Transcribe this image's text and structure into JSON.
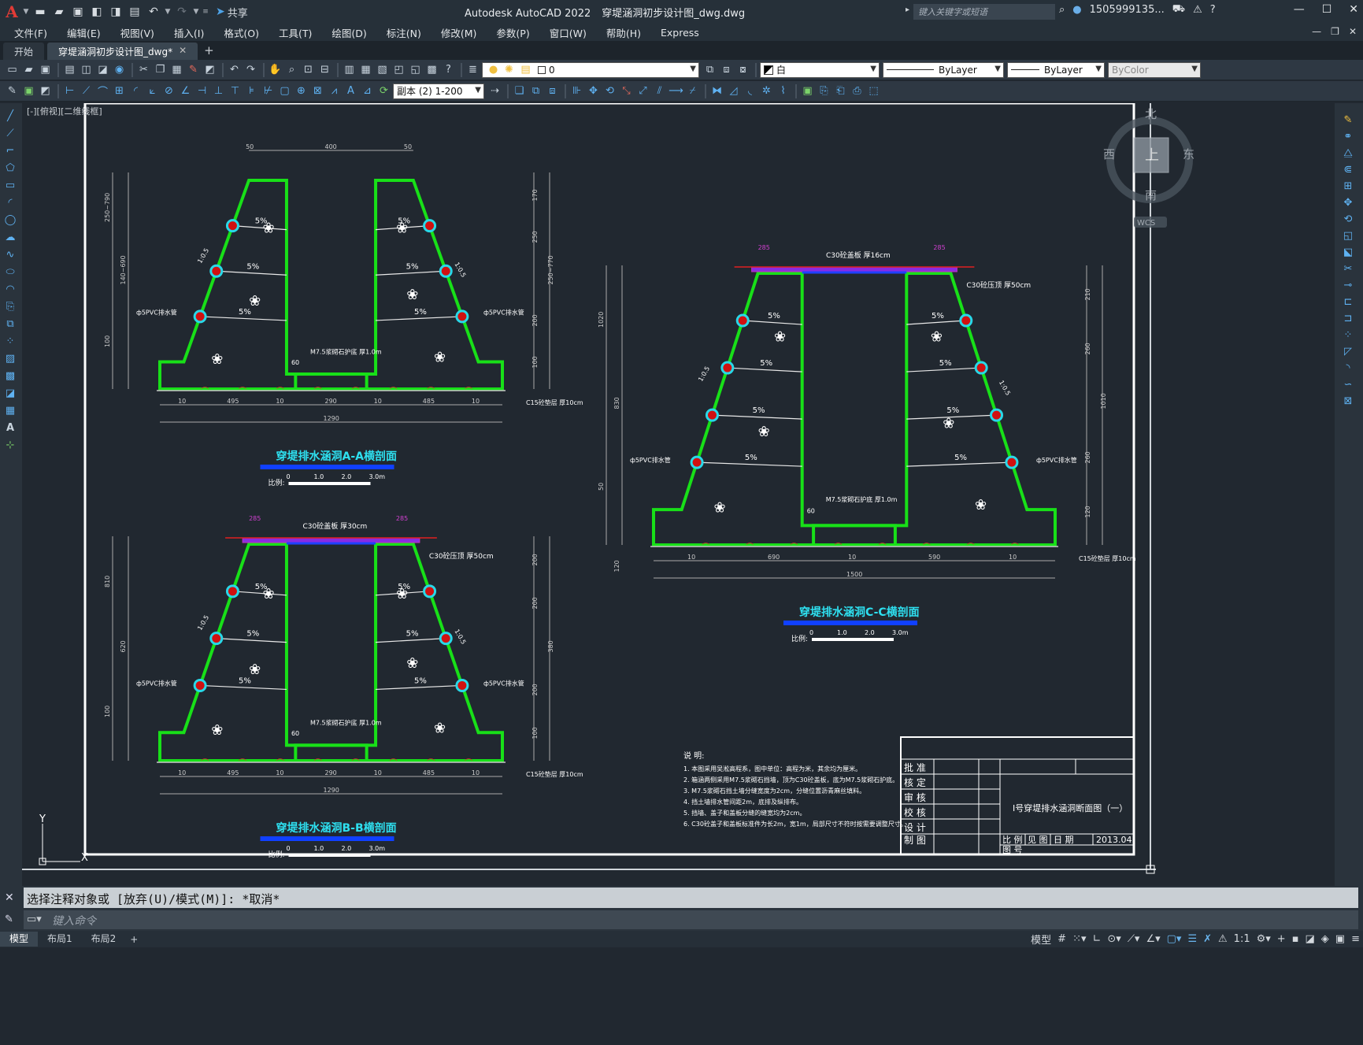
{
  "app": {
    "logo": "A",
    "title": "Autodesk AutoCAD 2022",
    "filename": "穿堤涵洞初步设计图_dwg.dwg",
    "share": "共享",
    "search_placeholder": "键入关键字或短语",
    "user": "1505999135..."
  },
  "menu": [
    "文件(F)",
    "编辑(E)",
    "视图(V)",
    "插入(I)",
    "格式(O)",
    "工具(T)",
    "绘图(D)",
    "标注(N)",
    "修改(M)",
    "参数(P)",
    "窗口(W)",
    "帮助(H)",
    "Express"
  ],
  "tabs": [
    {
      "label": "开始",
      "active": false
    },
    {
      "label": "穿堤涵洞初步设计图_dwg*",
      "active": true
    }
  ],
  "toolbar": {
    "layer": "0",
    "color": "白",
    "linetype": "ByLayer",
    "lineweight": "ByLayer",
    "plotstyle": "ByColor",
    "anno_scale": "副本 (2) 1-200"
  },
  "viewport_label": "[-][俯视][二维线框]",
  "viewcube": {
    "north": "北",
    "south": "南",
    "east": "东",
    "west": "西",
    "top": "上",
    "wcs": "WCS"
  },
  "ucs": {
    "y": "Y",
    "x": "X"
  },
  "drawing": {
    "sections": [
      {
        "title": "穿堤排水涵洞A-A横剖面",
        "scale_label": "比例:",
        "scale_ticks": [
          "0",
          "1.0",
          "2.0",
          "3.0m"
        ],
        "top_dims": [
          "50",
          "400",
          "50"
        ],
        "bottom_dims": [
          "10",
          "495",
          "10",
          "290",
          "10",
          "485",
          "10"
        ],
        "total": "1290",
        "left_heights": [
          "250~790",
          "140~690",
          "100"
        ],
        "right_heights": [
          "170",
          "250",
          "250~770",
          "200",
          "100"
        ],
        "slope_labels": [
          "5%",
          "5%",
          "5%",
          "5%",
          "5%",
          "5%"
        ],
        "pipe_label": "ф5PVC排水管",
        "ratio": "1:0.5",
        "side_dim": "60",
        "floor_label": "M7.5浆砌石护底 厚1.0m",
        "base_label": "C15砼垫层 厚10cm"
      },
      {
        "title": "穿堤排水涵洞B-B横剖面",
        "scale_label": "比例:",
        "scale_ticks": [
          "0",
          "1.0",
          "2.0",
          "3.0m"
        ],
        "top_dims": [
          "285",
          "285"
        ],
        "cover_label": "C30砼盖板 厚30cm",
        "cap_label": "C30砼压顶 厚50cm",
        "bottom_dims": [
          "10",
          "495",
          "10",
          "290",
          "10",
          "485",
          "10"
        ],
        "total": "1290",
        "left_heights": [
          "810",
          "620",
          "100"
        ],
        "right_heights": [
          "200",
          "200",
          "380",
          "200",
          "100"
        ],
        "slope_labels": [
          "5%",
          "5%",
          "5%",
          "5%",
          "5%",
          "5%"
        ],
        "pipe_label": "ф5PVC排水管",
        "ratio": "1:0.5",
        "side_dim": "60",
        "floor_label": "M7.5浆砌石护底 厚1.0m",
        "base_label": "C15砼垫层 厚10cm"
      },
      {
        "title": "穿堤排水涵洞C-C横剖面",
        "scale_label": "比例:",
        "scale_ticks": [
          "0",
          "1.0",
          "2.0",
          "3.0m"
        ],
        "top_dims": [
          "285",
          "285"
        ],
        "cover_label": "C30砼盖板 厚16cm",
        "cap_label": "C30砼压顶 厚50cm",
        "bottom_dims": [
          "10",
          "690",
          "10",
          "590",
          "10"
        ],
        "total": "1500",
        "left_heights": [
          "1020",
          "830",
          "50",
          "120"
        ],
        "right_heights": [
          "210",
          "260",
          "1010",
          "260",
          "120"
        ],
        "slope_labels": [
          "5%",
          "5%",
          "5%",
          "5%",
          "5%",
          "5%",
          "5%",
          "5%"
        ],
        "pipe_label": "ф5PVC排水管",
        "ratio": "1:0.5",
        "side_dim": "60",
        "floor_label": "M7.5浆砌石护底 厚1.0m",
        "base_label": "C15砼垫层 厚10cm"
      }
    ],
    "notes": {
      "title": "说 明:",
      "items": [
        "1. 本图采用吴淞高程系，图中单位：高程为米，其余均为厘米。",
        "2. 箱涵两侧采用M7.5浆砌石挡墙，顶为C30砼盖板，底为M7.5浆砌石护底。",
        "3. M7.5浆砌石挡土墙分缝宽度为2cm，分缝位置沥青麻丝填料。",
        "4. 挡土墙排水管间距2m，底排及纵排布。",
        "5. 挡墙、盖子和盖板分缝的缝宽均为2cm。",
        "6. C30砼盖子和盖板标准件为长2m，宽1m，局部尺寸不符时按需要调整尺寸。"
      ]
    },
    "titleblock": {
      "roles": [
        "批 准",
        "核 定",
        "审 核",
        "校 核",
        "设 计",
        "制 图"
      ],
      "drawing_name": "Ⅰ号穿堤排水涵洞断面图（一）",
      "scale_label": "比 例",
      "scale_value": "见 图",
      "date_label": "日 期",
      "date_value": "2013.04",
      "number_label": "图 号"
    }
  },
  "command": {
    "history": "选择注释对象或 [放弃(U)/模式(M)]: *取消*",
    "placeholder": "键入命令"
  },
  "status": {
    "tabs": [
      {
        "label": "模型",
        "active": true
      },
      {
        "label": "布局1",
        "active": false
      },
      {
        "label": "布局2",
        "active": false
      }
    ],
    "model": "模型",
    "scale": "1:1"
  }
}
